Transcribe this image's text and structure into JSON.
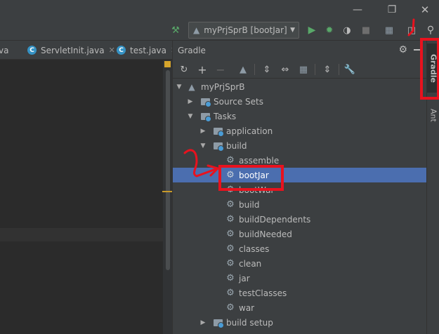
{
  "window": {
    "minimize_icon": "minimize-icon",
    "maximize_icon": "maximize-icon",
    "close_icon": "close-icon"
  },
  "toolbar": {
    "run_config": "myPrjSprB [bootJar]",
    "icons": [
      "hammer-icon",
      "run-icon",
      "debug-icon",
      "coverage-icon",
      "stop-icon",
      "project-structure-icon",
      "layout-icon",
      "search-icon"
    ]
  },
  "editor": {
    "tabs": [
      {
        "label": "va",
        "closable": false
      },
      {
        "label": "ServletInit.java",
        "closable": true
      },
      {
        "label": "test.java",
        "closable": true
      }
    ]
  },
  "gradle": {
    "title": "Gradle",
    "tree": [
      {
        "label": "myPrjSprB",
        "icon": "gradle-elephant-icon",
        "expanded": true
      },
      {
        "label": "Source Sets",
        "icon": "folder-icon",
        "expanded": false
      },
      {
        "label": "Tasks",
        "icon": "folder-icon",
        "expanded": true
      },
      {
        "label": "application",
        "icon": "folder-icon",
        "expanded": false
      },
      {
        "label": "build",
        "icon": "folder-icon",
        "expanded": true
      },
      {
        "label": "assemble",
        "icon": "gear-icon"
      },
      {
        "label": "bootJar",
        "icon": "gear-icon",
        "selected": true
      },
      {
        "label": "bootWar",
        "icon": "gear-icon"
      },
      {
        "label": "build",
        "icon": "gear-icon"
      },
      {
        "label": "buildDependents",
        "icon": "gear-icon"
      },
      {
        "label": "buildNeeded",
        "icon": "gear-icon"
      },
      {
        "label": "classes",
        "icon": "gear-icon"
      },
      {
        "label": "clean",
        "icon": "gear-icon"
      },
      {
        "label": "jar",
        "icon": "gear-icon"
      },
      {
        "label": "testClasses",
        "icon": "gear-icon"
      },
      {
        "label": "war",
        "icon": "gear-icon"
      },
      {
        "label": "build setup",
        "icon": "folder-icon",
        "expanded": false
      }
    ]
  },
  "right_strip": {
    "tabs": [
      "Gradle",
      "Ant"
    ]
  },
  "colors": {
    "selection": "#4b6eaf",
    "annotation": "#e8121e",
    "accent_run": "#59a869"
  }
}
